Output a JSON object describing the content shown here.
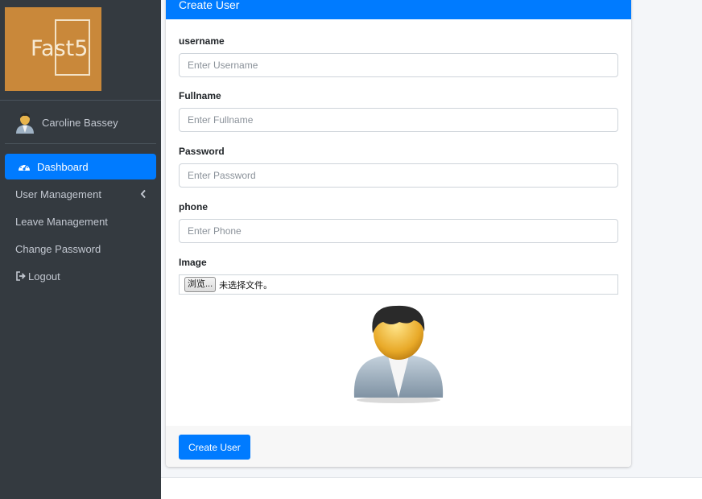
{
  "brand": {
    "logo_text": "Fast5",
    "accent": "#c9883a"
  },
  "user": {
    "name": "Caroline Bassey"
  },
  "nav": {
    "items": [
      {
        "label": "Dashboard",
        "icon": "tachometer-icon",
        "active": true
      },
      {
        "label": "User Management",
        "icon": "",
        "has_submenu": true
      },
      {
        "label": "Leave Management",
        "icon": ""
      },
      {
        "label": "Change Password",
        "icon": ""
      },
      {
        "label": "Logout",
        "icon": "sign-out-icon"
      }
    ]
  },
  "form": {
    "title": "Create User",
    "fields": [
      {
        "label": "username",
        "placeholder": "Enter Username",
        "value": ""
      },
      {
        "label": "Fullname",
        "placeholder": "Enter Fullname",
        "value": ""
      },
      {
        "label": "Password",
        "placeholder": "Enter Password",
        "value": ""
      },
      {
        "label": "phone",
        "placeholder": "Enter Phone",
        "value": ""
      }
    ],
    "image": {
      "label": "Image",
      "browse_label": "浏览...",
      "status": "未选择文件。"
    },
    "submit_label": "Create User"
  },
  "colors": {
    "primary": "#007bff",
    "sidebar": "#343a40"
  }
}
